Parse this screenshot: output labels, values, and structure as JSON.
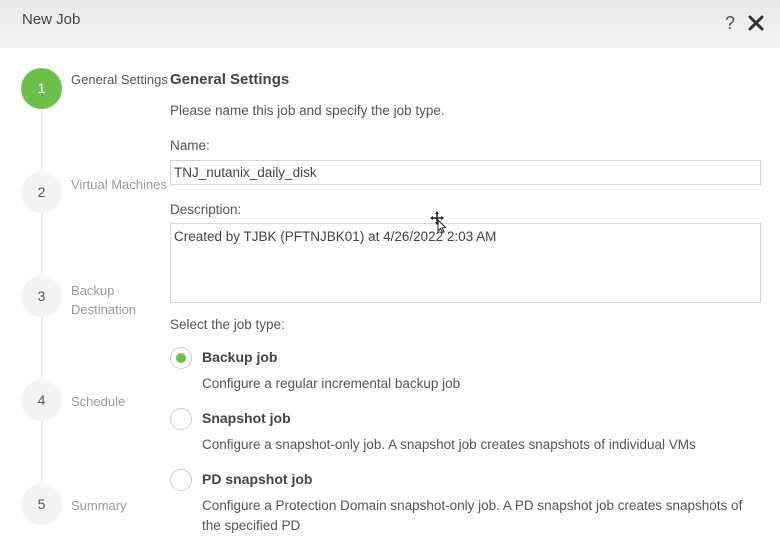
{
  "window": {
    "title": "New Job",
    "help_label": "?"
  },
  "steps": [
    {
      "number": "1",
      "label": "General Settings",
      "active": true
    },
    {
      "number": "2",
      "label": "Virtual Machines",
      "active": false
    },
    {
      "number": "3",
      "label": "Backup Destination",
      "active": false
    },
    {
      "number": "4",
      "label": "Schedule",
      "active": false
    },
    {
      "number": "5",
      "label": "Summary",
      "active": false
    }
  ],
  "content": {
    "section_title": "General Settings",
    "intro": "Please name this job and specify the job type.",
    "name_label": "Name:",
    "name_value": "TNJ_nutanix_daily_disk",
    "description_label": "Description:",
    "description_value": "Created by TJBK (PFTNJBK01) at 4/26/2022 2:03 AM",
    "job_type_label": "Select the job type:",
    "job_types": [
      {
        "title": "Backup job",
        "description": "Configure a regular incremental backup job",
        "selected": true
      },
      {
        "title": "Snapshot job",
        "description": "Configure a snapshot-only job. A snapshot job creates snapshots of individual VMs",
        "selected": false
      },
      {
        "title": "PD snapshot job",
        "description": "Configure a Protection Domain snapshot-only job. A PD snapshot job creates snapshots of the specified PD",
        "selected": false
      }
    ]
  },
  "colors": {
    "accent": "#6cc04a",
    "titlebar": "#ececec"
  },
  "icons": {
    "close": "close-icon",
    "help": "help-icon",
    "cursor": "move-cursor-icon"
  }
}
